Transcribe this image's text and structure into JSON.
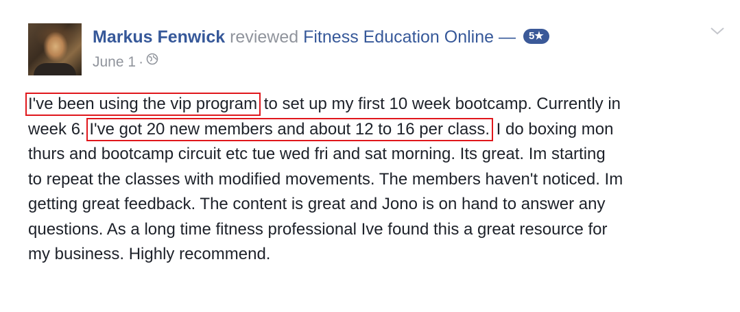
{
  "post": {
    "author": "Markus Fenwick",
    "verb": "reviewed",
    "page_name": "Fitness Education Online",
    "dash": "—",
    "rating": "5★",
    "date": "June 1",
    "separator": "·",
    "privacy_icon": "globe-icon",
    "menu_icon": "chevron-down-icon",
    "highlight_color": "#e0161b",
    "body": {
      "line1_highlight": "I've been using the vip program",
      "line1_rest": " to set up my first 10 week bootcamp. Currently in",
      "line2_start": "week 6.",
      "line2_highlight": "I've got 20 new members and about 12 to 16 per class.",
      "line2_rest": " I do boxing mon",
      "line3": "thurs and bootcamp circuit etc tue wed fri and sat morning. Its great. Im starting",
      "line4": "to repeat the classes with modified movements. The members haven't noticed. Im",
      "line5": "getting great feedback. The content is great and Jono is on hand to answer any",
      "line6": "questions. As a long time fitness professional Ive found this a great resource for",
      "line7": "my business. Highly recommend."
    }
  }
}
